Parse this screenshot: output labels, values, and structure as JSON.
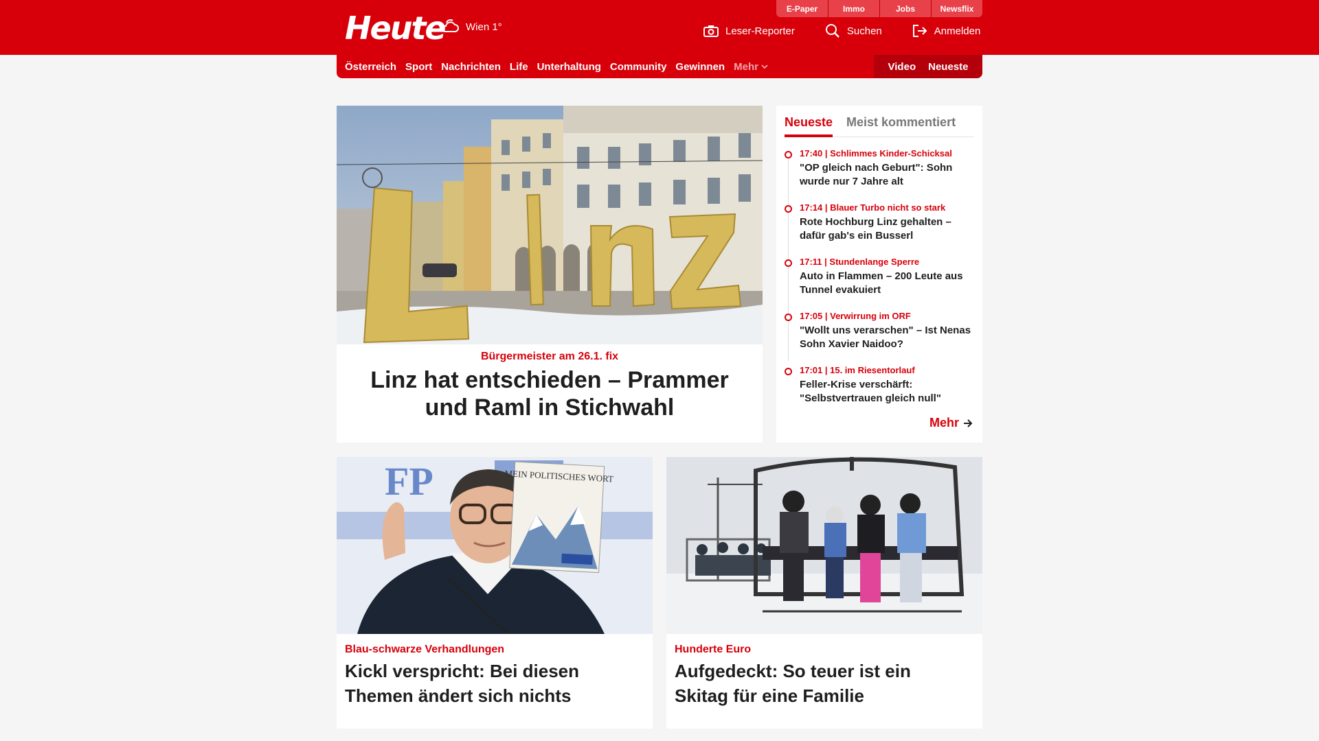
{
  "header": {
    "logo": "Heute",
    "weather": "Wien 1°",
    "services": [
      "E-Paper",
      "Immo",
      "Jobs",
      "Newsflix"
    ],
    "actions": {
      "reporter": "Leser-Reporter",
      "search": "Suchen",
      "login": "Anmelden"
    }
  },
  "nav": {
    "items": [
      "Österreich",
      "Sport",
      "Nachrichten",
      "Life",
      "Unterhaltung",
      "Community",
      "Gewinnen"
    ],
    "more": "Mehr",
    "video": "Video",
    "latest": "Neueste"
  },
  "hero": {
    "kicker": "Bürgermeister am 26.1. fix",
    "headline": "Linz hat entschieden – Prammer und Raml in Stichwahl"
  },
  "sidebar": {
    "tabs": [
      "Neueste",
      "Meist kommentiert"
    ],
    "items": [
      {
        "kicker": "17:40 | Schlimmes Kinder-Schicksal",
        "title": "\"OP gleich nach Geburt\": Sohn wurde nur 7 Jahre alt"
      },
      {
        "kicker": "17:14 | Blauer Turbo nicht so stark",
        "title": "Rote Hochburg Linz gehalten – dafür gab's ein Busserl"
      },
      {
        "kicker": "17:11 | Stundenlange Sperre",
        "title": "Auto in Flammen – 200 Leute aus Tunnel evakuiert"
      },
      {
        "kicker": "17:05 | Verwirrung im ORF",
        "title": "\"Wollt uns verarschen\" – Ist Nenas Sohn Xavier Naidoo?"
      },
      {
        "kicker": "17:01 | 15. im Riesentorlauf",
        "title": "Feller-Krise verschärft: \"Selbstvertrauen gleich null\""
      }
    ],
    "more": "Mehr"
  },
  "articles": [
    {
      "kicker": "Blau-schwarze Verhandlungen",
      "headline": "Kickl verspricht: Bei diesen Themen ändert sich nichts"
    },
    {
      "kicker": "Hunderte Euro",
      "headline": "Aufgedeckt: So teuer ist ein Skitag für eine Familie"
    }
  ],
  "images": {
    "hero_sign": "Linz",
    "poster_title": "MEIN POLITISCHES WORT",
    "backdrop_text": "FP"
  },
  "colors": {
    "brand": "#d7000a",
    "brand_dark": "#b4000a",
    "service_tab": "#e8414a",
    "page_bg": "#f5f5f5"
  }
}
